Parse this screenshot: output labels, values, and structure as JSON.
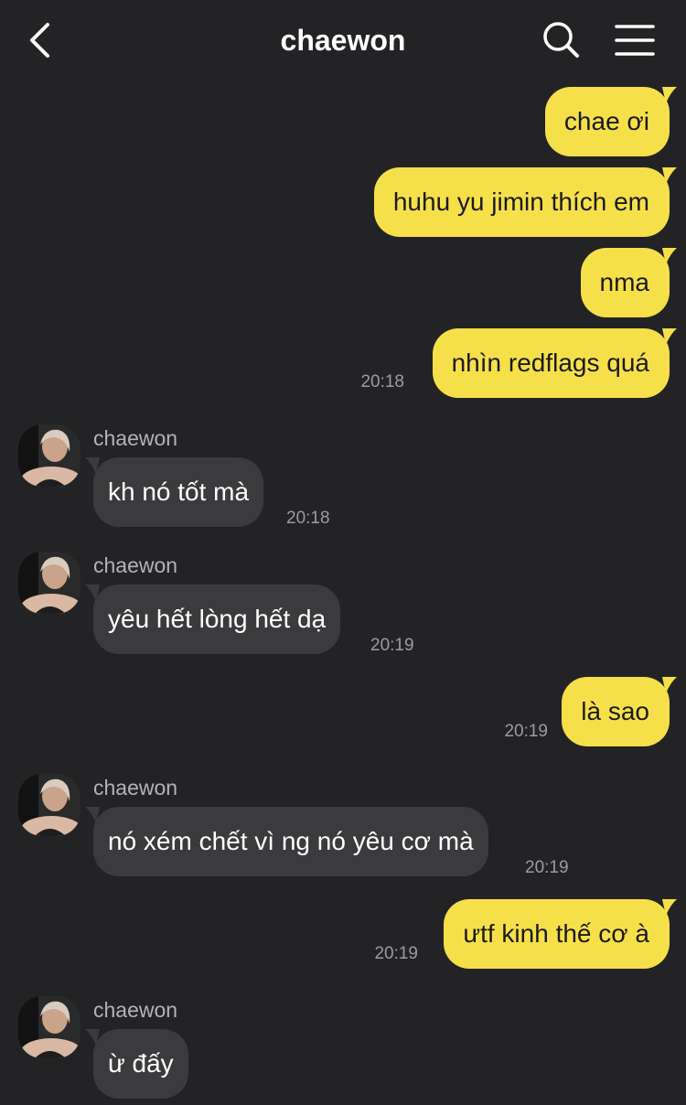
{
  "header": {
    "title": "chaewon",
    "back_icon": "chevron-left-icon",
    "search_icon": "search-icon",
    "menu_icon": "hamburger-menu-icon"
  },
  "colors": {
    "background": "#232326",
    "outgoing_bubble": "#f6e04a",
    "incoming_bubble": "#3b3b3e",
    "timestamp": "#9c9c9f"
  },
  "messages": [
    {
      "direction": "out",
      "text": "chae ơi"
    },
    {
      "direction": "out",
      "text": "huhu yu jimin thích em"
    },
    {
      "direction": "out",
      "text": "nma"
    },
    {
      "direction": "out",
      "text": "nhìn redflags quá",
      "time": "20:18"
    },
    {
      "direction": "in",
      "sender": "chaewon",
      "text": "kh nó tốt mà",
      "time": "20:18"
    },
    {
      "direction": "in",
      "sender": "chaewon",
      "text": "yêu hết lòng hết dạ",
      "time": "20:19"
    },
    {
      "direction": "out",
      "text": "là sao",
      "time": "20:19"
    },
    {
      "direction": "in",
      "sender": "chaewon",
      "text": "nó xém chết vì ng nó yêu cơ mà",
      "time": "20:19"
    },
    {
      "direction": "out",
      "text": "ưtf kinh thế cơ à",
      "time": "20:19"
    },
    {
      "direction": "in",
      "sender": "chaewon",
      "text": "ừ đấy"
    }
  ]
}
